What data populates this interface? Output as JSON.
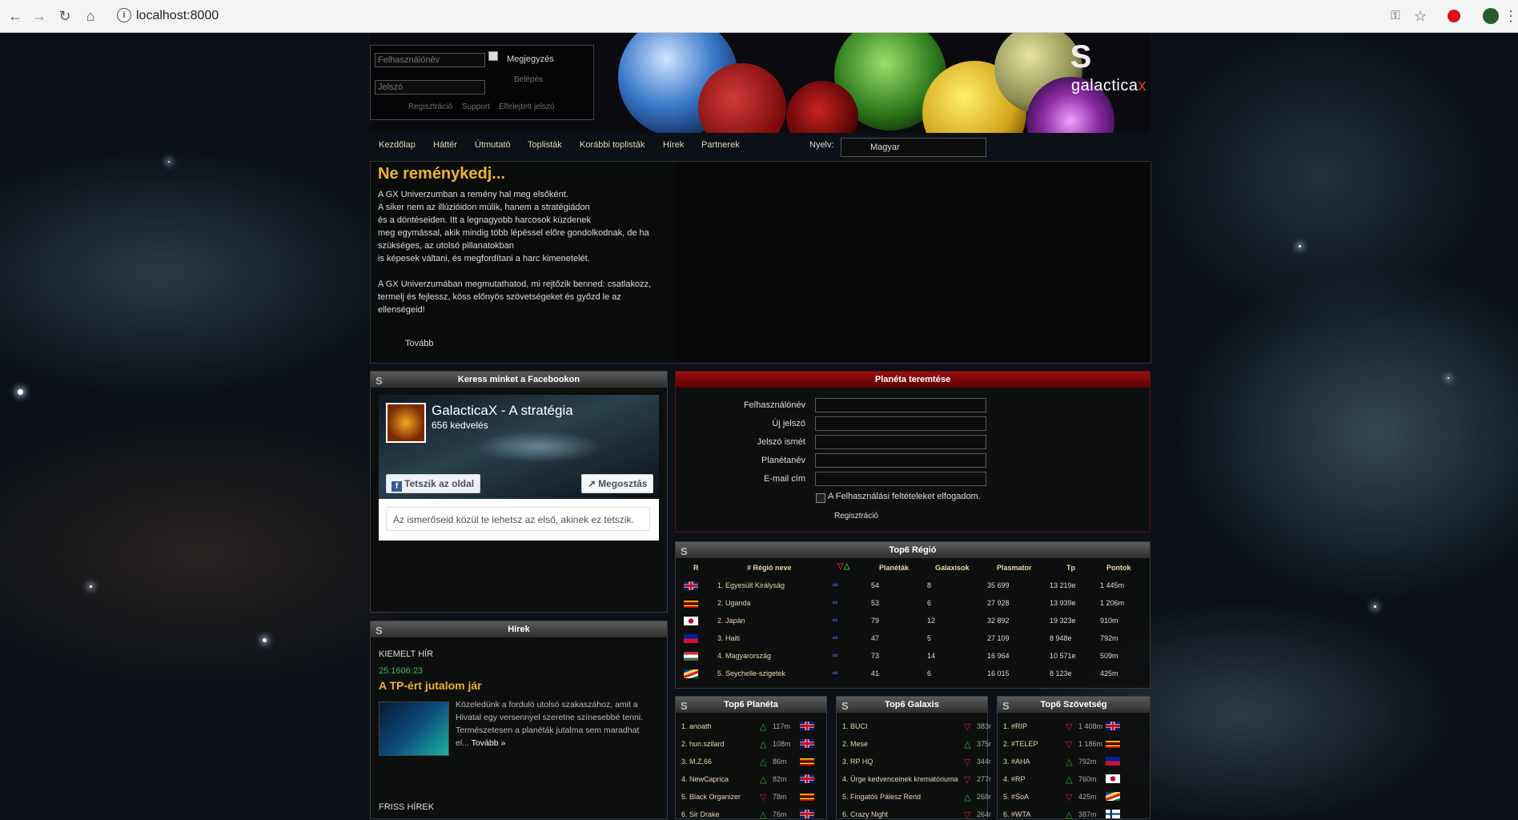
{
  "browser": {
    "url": "localhost:8000"
  },
  "login": {
    "username_placeholder": "Felhasználónév",
    "password_placeholder": "Jelszó",
    "remember_label": "Megjegyzés",
    "login_label": "Belépés",
    "register_link": "Regisztráció",
    "support_link": "Support",
    "forgot_link": "Elfelejtett jelszó"
  },
  "brand": {
    "name_main": "galactica",
    "name_x": "x"
  },
  "menu": {
    "items": [
      "Kezdőlap",
      "Háttér",
      "Útmutató",
      "Toplisták",
      "Korábbi toplisták",
      "Hírek",
      "Partnerek"
    ],
    "language_label": "Nyelv:",
    "language_value": "Magyar"
  },
  "hero": {
    "title": "Ne reménykedj...",
    "p1": [
      "A GX Univerzumban a remény hal meg elsőként.",
      "A siker nem az illúzióidon múlik, hanem a stratégiádon",
      "és a döntéseiden. Itt a legnagyobb harcosok küzdenek",
      "meg egymással, akik mindig több lépéssel előre gondolkodnak, de ha",
      "szükséges, az utolsó pillanatokban",
      "is képesek váltani, és megfordítani a harc kimenetelét."
    ],
    "p2": [
      "A GX Univerzumában megmutathatod, mi rejtőzik benned: csatlakozz,",
      "termelj és fejlessz, köss előnyös szövetségeket és győzd le az",
      "ellenségeid!"
    ],
    "more": "Tovább"
  },
  "facebook": {
    "header": "Keress minket a Facebookon",
    "page_name": "GalacticaX - A stratégia",
    "likes": "656 kedvelés",
    "like_button": "Tetszik az oldal",
    "share_button": "Megosztás",
    "friends_text": "Az ismerőseid közül te lehetsz az első, akinek ez tetszik."
  },
  "registration": {
    "header": "Planéta teremtése",
    "fields": [
      "Felhasználónév",
      "Új jelszó",
      "Jelszó ismét",
      "Planétanév",
      "E-mail cím"
    ],
    "terms_label": "A Felhasználási feltételeket elfogadom.",
    "submit_label": "Regisztráció"
  },
  "news": {
    "header": "Hírek",
    "featured_label": "KIEMELT HÍR",
    "timer": "25:1606:23",
    "title": "A TP-ért jutalom jár",
    "body": [
      "Közeledünk a forduló utolsó szakaszához, amit a",
      "Hivatal egy versennyel szeretne színesebbé tenni.",
      "Természetesen a planéták jutalma sem maradhat",
      "el..."
    ],
    "more": "Tovább »",
    "fresh_label": "FRISS HÍREK"
  },
  "top_region": {
    "header": "Top6 Régió",
    "columns": [
      "R",
      "# Régió neve",
      "Planéták",
      "Galaxisok",
      "Plasmator",
      "Tp",
      "Pontok"
    ],
    "rows": [
      {
        "flag": "uk",
        "name": "1. Egyesült Királyság",
        "planets": "54",
        "galaxies": "8",
        "plasmator": "35 699",
        "tp": "13 219e",
        "points": "1 445m"
      },
      {
        "flag": "ug",
        "name": "2. Uganda",
        "planets": "53",
        "galaxies": "6",
        "plasmator": "27 928",
        "tp": "13 939e",
        "points": "1 206m"
      },
      {
        "flag": "jp",
        "name": "2. Japán",
        "planets": "79",
        "galaxies": "12",
        "plasmator": "32 892",
        "tp": "19 323e",
        "points": "910m"
      },
      {
        "flag": "ht",
        "name": "3. Haiti",
        "planets": "47",
        "galaxies": "5",
        "plasmator": "27 109",
        "tp": "8 948e",
        "points": "792m"
      },
      {
        "flag": "hu",
        "name": "4. Magyarország",
        "planets": "73",
        "galaxies": "14",
        "plasmator": "16 964",
        "tp": "10 571e",
        "points": "509m"
      },
      {
        "flag": "sc",
        "name": "5. Seychelle-szigetek",
        "planets": "41",
        "galaxies": "6",
        "plasmator": "16 015",
        "tp": "8 123e",
        "points": "425m"
      }
    ]
  },
  "top_planet": {
    "header": "Top6 Planéta",
    "rows": [
      {
        "name": "1. anoath",
        "trend": "up",
        "value": "117m",
        "flag": "uk"
      },
      {
        "name": "2. hun.szilard",
        "trend": "up",
        "value": "108m",
        "flag": "uk"
      },
      {
        "name": "3. M.Z.66",
        "trend": "up",
        "value": "86m",
        "flag": "ug"
      },
      {
        "name": "4. NewCaprica",
        "trend": "up",
        "value": "82m",
        "flag": "uk"
      },
      {
        "name": "5. Black Organizer",
        "trend": "down",
        "value": "78m",
        "flag": "ug"
      },
      {
        "name": "6. Sir Drake",
        "trend": "up",
        "value": "76m",
        "flag": "uk"
      }
    ]
  },
  "top_galaxy": {
    "header": "Top6 Galaxis",
    "rows": [
      {
        "name": "1. BUCI",
        "trend": "down",
        "value": "383r"
      },
      {
        "name": "2. Mese",
        "trend": "up",
        "value": "375r"
      },
      {
        "name": "3. RP HQ",
        "trend": "down",
        "value": "344r"
      },
      {
        "name": "4. Ürge kedvenceinek krematóriuma",
        "trend": "down",
        "value": "277r"
      },
      {
        "name": "5. Fingatós Pálesz Rend",
        "trend": "up",
        "value": "268r"
      },
      {
        "name": "6. Crazy Night",
        "trend": "down",
        "value": "264r"
      }
    ]
  },
  "top_alliance": {
    "header": "Top6 Szövetség",
    "rows": [
      {
        "name": "1. #RIP",
        "trend": "down",
        "value": "1 408m",
        "flag": "uk"
      },
      {
        "name": "2. #TELEP",
        "trend": "down",
        "value": "1 186m",
        "flag": "ug"
      },
      {
        "name": "3. #AHA",
        "trend": "up",
        "value": "792m",
        "flag": "ht"
      },
      {
        "name": "4. #RP",
        "trend": "up",
        "value": "760m",
        "flag": "jp"
      },
      {
        "name": "5. #SoA",
        "trend": "down",
        "value": "425m",
        "flag": "sc"
      },
      {
        "name": "6. #WTA",
        "trend": "up",
        "value": "387m",
        "flag": "fi"
      }
    ]
  },
  "colors": {
    "accent_gold": "#f0b429",
    "header_red": "#8a0c0c",
    "menu_text": "#e8d9b0",
    "logo_red": "#e23b2c"
  }
}
